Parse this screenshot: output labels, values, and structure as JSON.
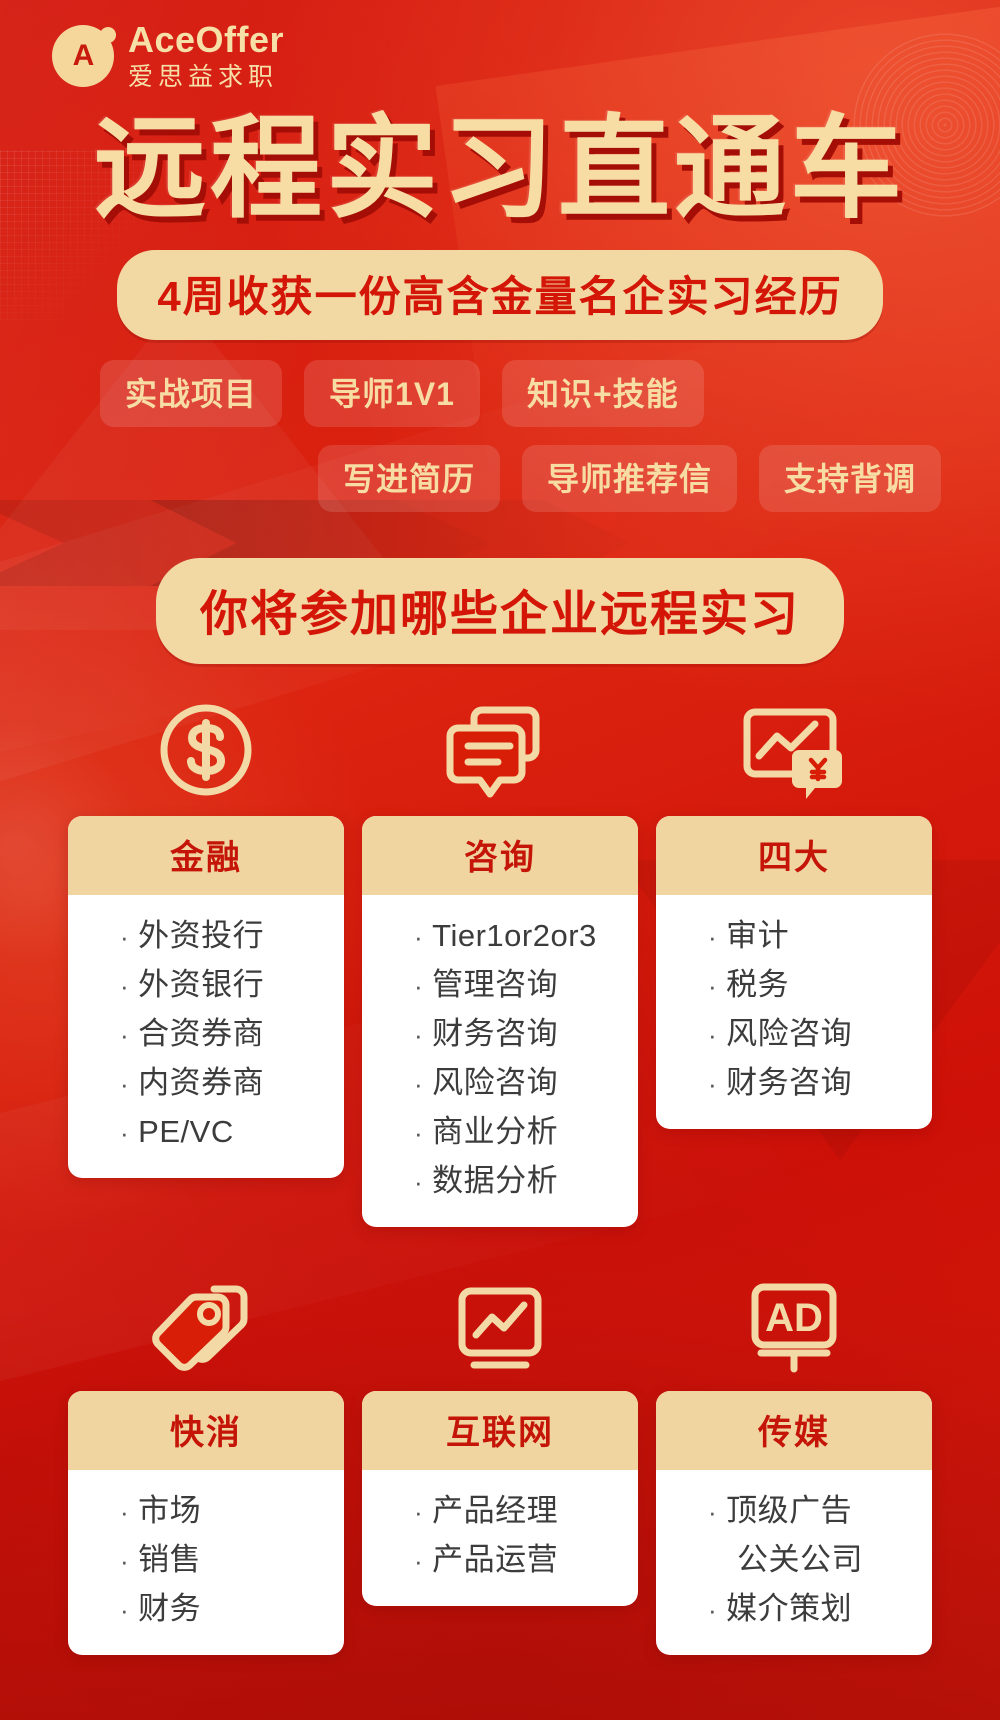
{
  "brand": {
    "mark_letter": "A",
    "name_en": "AceOffer",
    "name_cn": "爱思益求职"
  },
  "hero": {
    "title": "远程实习直通车",
    "subtitle": "4周收获一份高含金量名企实习经历",
    "tags_row1": [
      "实战项目",
      "导师1V1",
      "知识+技能"
    ],
    "tags_row2": [
      "写进简历",
      "导师推荐信",
      "支持背调"
    ]
  },
  "section": {
    "header": "你将参加哪些企业远程实习"
  },
  "colors": {
    "background_red": "#D81E06",
    "gold": "#F2D9A4",
    "title_gold": "#F7DCA4",
    "deep_red_text": "#D31607",
    "card_head_bg": "#F0D5A0",
    "card_body_bg": "#FFFFFF",
    "item_text": "#3C3C3C"
  },
  "cards": [
    {
      "icon": "dollar-coin-icon",
      "title": "金融",
      "items": [
        "外资投行",
        "外资银行",
        "合资券商",
        "内资券商",
        "PE/VC"
      ]
    },
    {
      "icon": "speech-bubbles-icon",
      "title": "咨询",
      "items": [
        "Tier1or2or3",
        "管理咨询",
        "财务咨询",
        "风险咨询",
        "商业分析",
        "数据分析"
      ]
    },
    {
      "icon": "chart-yen-icon",
      "title": "四大",
      "items": [
        "审计",
        "税务",
        "风险咨询",
        "财务咨询"
      ]
    },
    {
      "icon": "price-tags-icon",
      "title": "快消",
      "items": [
        "市场",
        "销售",
        "财务"
      ]
    },
    {
      "icon": "chart-monitor-icon",
      "title": "互联网",
      "items": [
        "产品经理",
        "产品运营"
      ]
    },
    {
      "icon": "ad-board-icon",
      "title": "传媒",
      "items": [
        "顶级广告",
        "公关公司",
        "媒介策划"
      ]
    }
  ],
  "bullet": "·"
}
